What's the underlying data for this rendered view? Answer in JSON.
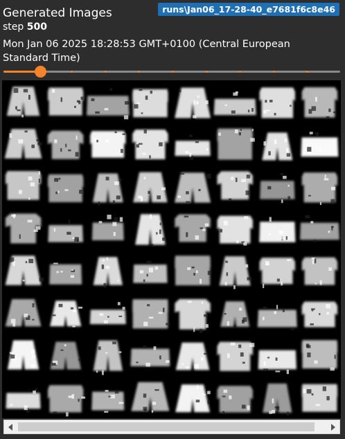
{
  "card": {
    "title": "Generated Images",
    "run_tag": "runs\\Jan06_17-28-40_e7681f6c8e46",
    "step_label": "step",
    "step_value": "500",
    "timestamp": "Mon Jan 06 2025 18:28:53 GMT+0100 (Central European Standard Time)"
  },
  "slider": {
    "value_fraction": 0.11,
    "tick_count": 10,
    "accent_color": "#f5832a"
  },
  "image_grid": {
    "rows": 8,
    "cols": 8,
    "background": "#000000"
  },
  "scrollbar": {
    "left_icon": "arrow-left-icon",
    "right_icon": "arrow-right-icon"
  },
  "colors": {
    "card_bg": "#2d2d2d",
    "badge_bg": "#1f6fb5"
  }
}
